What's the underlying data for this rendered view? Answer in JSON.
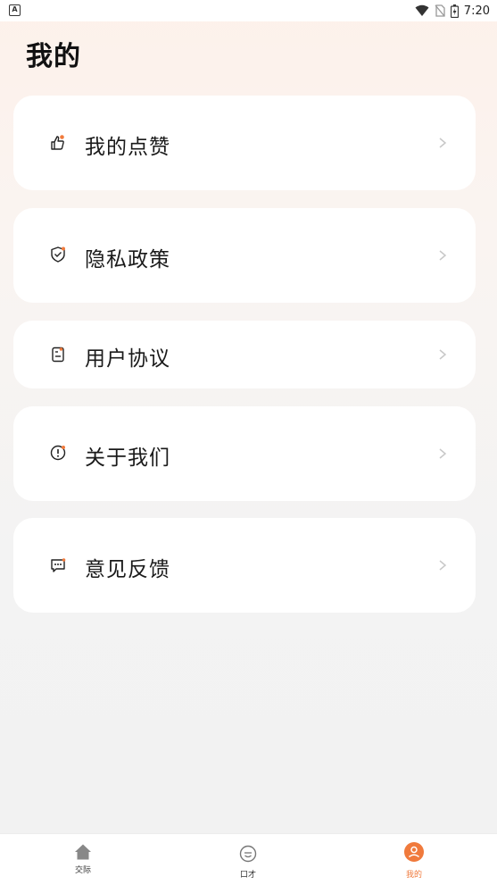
{
  "status_bar": {
    "time": "7:20",
    "badge": "A",
    "icons": [
      "wifi-icon",
      "no-sim-icon",
      "battery-charging-icon"
    ]
  },
  "page": {
    "title": "我的"
  },
  "menu": {
    "items": [
      {
        "label": "我的点赞",
        "icon": "thumbs-up-icon"
      },
      {
        "label": "隐私政策",
        "icon": "shield-check-icon"
      },
      {
        "label": "用户协议",
        "icon": "document-icon"
      },
      {
        "label": "关于我们",
        "icon": "info-circle-icon"
      },
      {
        "label": "意见反馈",
        "icon": "chat-bubble-icon"
      }
    ]
  },
  "tab_bar": {
    "tabs": [
      {
        "label": "交际",
        "icon": "home-icon",
        "active": false
      },
      {
        "label": "口才",
        "icon": "face-smile-icon",
        "active": false
      },
      {
        "label": "我的",
        "icon": "user-icon",
        "active": true
      }
    ]
  },
  "colors": {
    "accent": "#f07a3c",
    "icon_dot": "#f07a3c",
    "chevron": "#c8c8c8"
  }
}
